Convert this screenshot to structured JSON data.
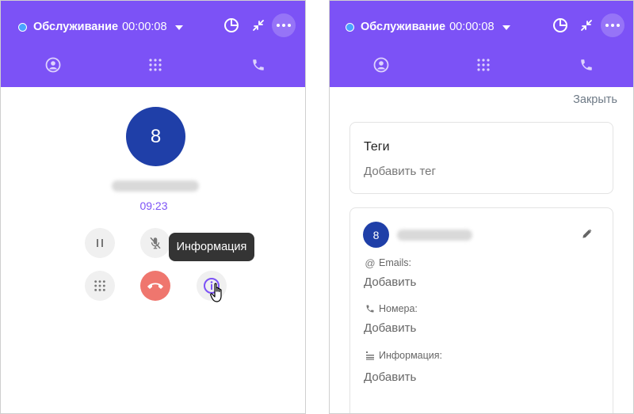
{
  "left": {
    "status": {
      "label": "Обслуживание",
      "timer": "00:00:08"
    },
    "contact_avatar_letter": "8",
    "call_timer": "09:23",
    "tooltip": "Информация"
  },
  "right": {
    "status": {
      "label": "Обслуживание",
      "timer": "00:00:08"
    },
    "close_label": "Закрыть",
    "tags": {
      "title": "Теги",
      "add_label": "Добавить тег"
    },
    "contact": {
      "avatar_letter": "8",
      "emails": {
        "label": "Emails:",
        "add_label": "Добавить"
      },
      "phones": {
        "label": "Номера:",
        "add_label": "Добавить"
      },
      "info": {
        "label": "Информация:",
        "add_label": "Добавить"
      }
    }
  },
  "colors": {
    "header": "#7c52f6",
    "avatar": "#1f3fa8",
    "hangup": "#ef766e",
    "accent": "#7c52f6",
    "status_dot": "#4aa3ff"
  },
  "icons": {
    "header": [
      "pie-chart-icon",
      "minimize-icon",
      "more-icon"
    ],
    "tabs": [
      "contact-icon",
      "dialpad-icon",
      "phone-icon"
    ],
    "call_controls": [
      "pause-icon",
      "mic-off-icon",
      "dialpad-icon",
      "hangup-icon",
      "info-icon"
    ]
  }
}
